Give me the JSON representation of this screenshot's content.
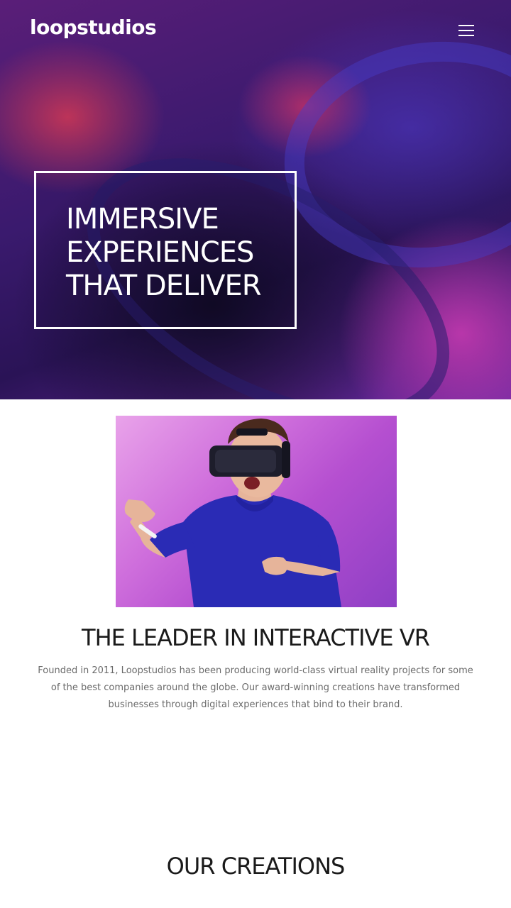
{
  "header": {
    "logo": "loopstudios",
    "menu_icon": "hamburger-menu-icon"
  },
  "hero": {
    "title_lines": [
      "IMMERSIVE",
      "EXPERIENCES",
      "THAT DELIVER"
    ]
  },
  "about": {
    "image_icon": "person-with-vr-headset-photo",
    "title": "THE LEADER IN INTERACTIVE VR",
    "text": "Founded in 2011, Loopstudios has been producing world-class virtual reality projects for some of the best companies around the globe. Our award-winning creations have transformed businesses through digital experiences that bind to their brand."
  },
  "creations": {
    "title": "OUR CREATIONS"
  },
  "colors": {
    "text_dark": "#1a1a1a",
    "text_muted": "#6b6b6b",
    "white": "#ffffff",
    "hero_purple": "#3a1a6e",
    "photo_pink": "#cf6fdc",
    "shirt_blue": "#2a2bb5"
  }
}
